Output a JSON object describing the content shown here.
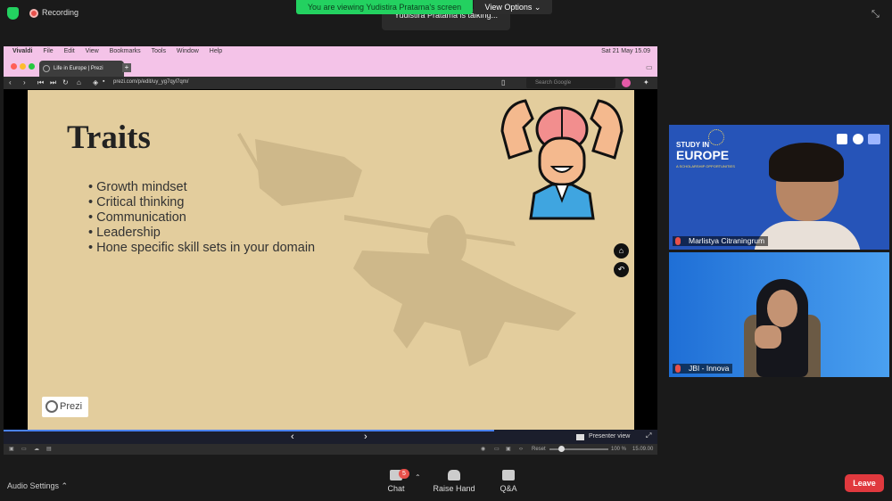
{
  "zoom": {
    "recording_label": "Recording",
    "viewing_banner": "You are viewing Yudistira Pratama's screen",
    "view_options_label": "View Options ⌄",
    "talking_text": "Yudistira Pratama is talking..."
  },
  "browser": {
    "app_name": "Vivaldi",
    "menu": [
      "File",
      "Edit",
      "View",
      "Bookmarks",
      "Tools",
      "Window",
      "Help"
    ],
    "datetime": "Sat 21 May 15.09",
    "tab_title": "Life in Europe | Prezi",
    "url": "prezi.com/p/edit/uy_yg7qyl7qm/",
    "search_placeholder": "Search Google",
    "zoom_level": "100 %",
    "time": "15.09.00",
    "reset_label": "Reset",
    "presenter_view_label": "Presenter view"
  },
  "slide": {
    "title": "Traits",
    "bullets": [
      "Growth mindset",
      "Critical thinking",
      "Communication",
      "Leadership",
      "Hone specific skill sets in your domain"
    ],
    "logo_text": "Prezi"
  },
  "participants": [
    {
      "name": "Marlistya Citraningrum",
      "banner_line1": "STUDY IN",
      "banner_line2": "EUROPE",
      "banner_line3": "A SCHOLARSHIP OPPORTUNITIES"
    },
    {
      "name": "JBI - Innova"
    }
  ],
  "toolbar": {
    "audio_settings_label": "Audio Settings ⌃",
    "chat_label": "Chat",
    "chat_badge": "5",
    "raise_hand_label": "Raise Hand",
    "qa_label": "Q&A",
    "leave_label": "Leave"
  },
  "colors": {
    "zoom_green": "#23d160",
    "slide_bg": "#e3cd9d",
    "leave_red": "#e0393e",
    "tile_blue": "#2f5bc4",
    "browser_pink": "#f4c3e8"
  }
}
